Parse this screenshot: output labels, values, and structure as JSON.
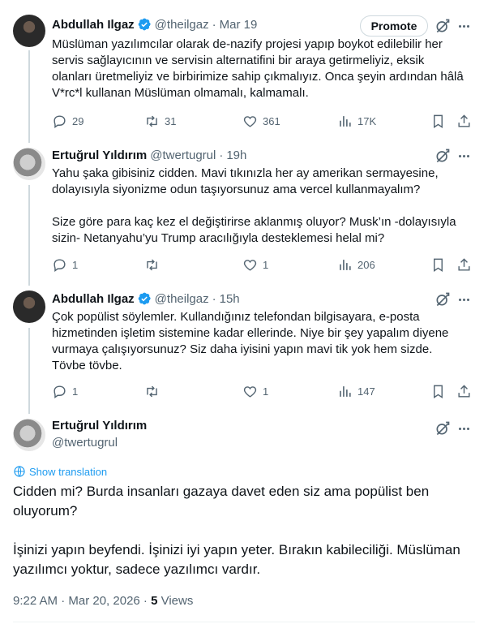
{
  "tweets": [
    {
      "name": "Abdullah Ilgaz",
      "verified": true,
      "handle": "@theilgaz",
      "time": "Mar 19",
      "promote_label": "Promote",
      "text": "Müslüman yazılımcılar olarak de-nazify projesi yapıp boykot edilebilir her\nservis sağlayıcının ve servisin alternatifini bir araya getirmeliyiz, eksik\nolanları üretmeliyiz ve birbirimize sahip çıkmalıyız. Onca şeyin ardından hâlâ\nV*rc*l kullanan Müslüman olmamalı, kalmamalı.",
      "replies": "29",
      "reposts": "31",
      "likes": "361",
      "views": "17K"
    },
    {
      "name": "Ertuğrul Yıldırım",
      "verified": false,
      "handle": "@twertugrul",
      "time": "19h",
      "text": "Yahu şaka gibisiniz cidden. Mavi tıkınızla her ay amerikan sermayesine,\ndolayısıyla siyonizme odun taşıyorsunuz ama vercel kullanmayalım?\n\nSize göre para kaç kez el değiştirirse aklanmış oluyor? Musk’ın -dolayısıyla\nsizin- Netanyahu’yu Trump aracılığıyla desteklemesi helal mi?",
      "replies": "1",
      "reposts": "",
      "likes": "1",
      "views": "206"
    },
    {
      "name": "Abdullah Ilgaz",
      "verified": true,
      "handle": "@theilgaz",
      "time": "15h",
      "text": "Çok popülist söylemler. Kullandığınız telefondan bilgisayara, e-posta\nhizmetinden işletim sistemine kadar ellerinde. Niye bir şey yapalım diyene\nvurmaya çalışıyorsunuz? Siz daha iyisini yapın mavi tik yok hem sizde.\nTövbe tövbe.",
      "replies": "1",
      "reposts": "",
      "likes": "1",
      "views": "147"
    }
  ],
  "focused": {
    "name": "Ertuğrul Yıldırım",
    "handle": "@twertugrul",
    "show_translation": "Show translation",
    "text": "Cidden mi? Burda insanları gazaya davet eden siz ama popülist ben\noluyorum?\n\nİşinizi yapın beyfendi. İşinizi iyi yapın yeter. Bırakın kabileciliği. Müslüman\nyazılımcı yoktur, sadece yazılımcı vardır.",
    "time": "9:22 AM · Mar 20, 2026 · ",
    "views_count": "5",
    "views_label": " Views"
  },
  "colors": {
    "accent": "#1d9bf0",
    "text": "#0f1419",
    "secondary": "#536471",
    "line": "#cfd9de"
  }
}
